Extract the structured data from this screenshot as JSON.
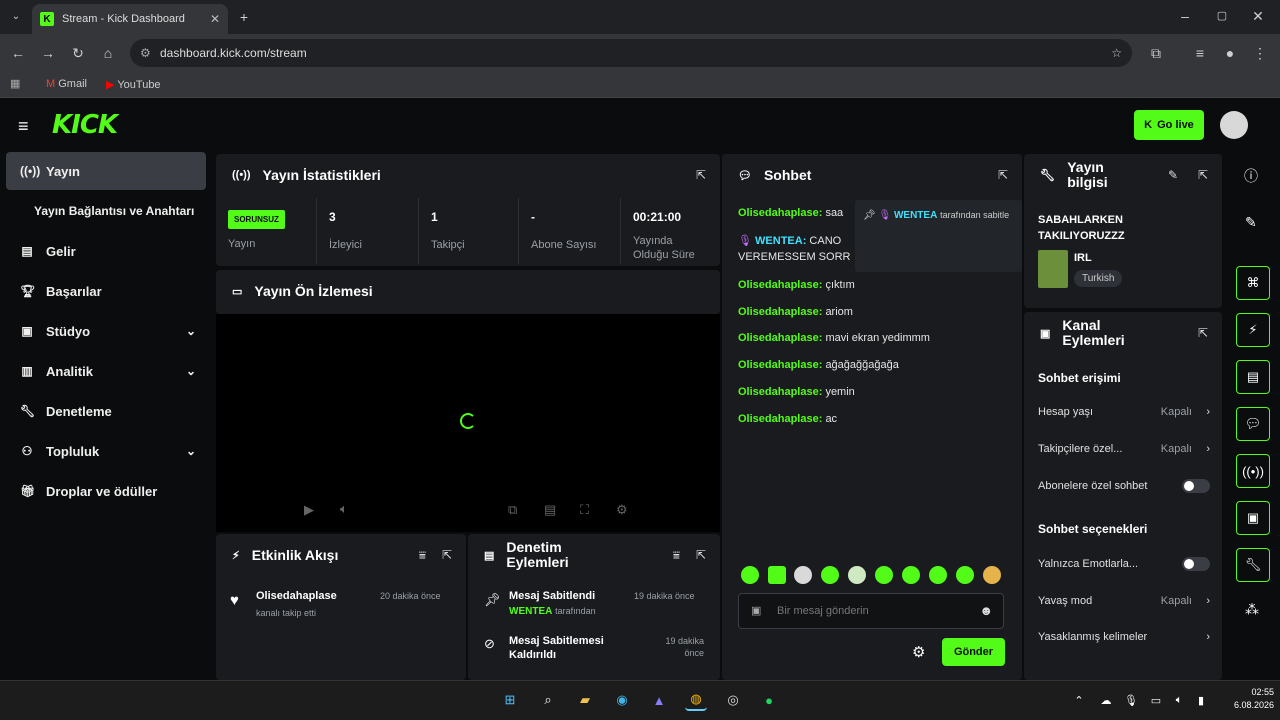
{
  "browser": {
    "tab_title": "Stream - Kick Dashboard",
    "url": "dashboard.kick.com/stream",
    "bookmarks": [
      "Gmail",
      "YouTube"
    ]
  },
  "header": {
    "logo": "KICK",
    "go_live": "Go live"
  },
  "sidebar": {
    "items": [
      {
        "label": "Yayın",
        "icon": "broadcast-icon"
      },
      {
        "label": "Yayın Bağlantısı ve Anahtarı",
        "icon": ""
      },
      {
        "label": "Gelir",
        "icon": "revenue-icon"
      },
      {
        "label": "Başarılar",
        "icon": "trophy-icon"
      },
      {
        "label": "Stüdyo",
        "icon": "studio-icon"
      },
      {
        "label": "Analitik",
        "icon": "analytics-icon"
      },
      {
        "label": "Denetleme",
        "icon": "wrench-icon"
      },
      {
        "label": "Topluluk",
        "icon": "community-icon"
      },
      {
        "label": "Droplar ve ödüller",
        "icon": "gift-icon"
      }
    ]
  },
  "stats": {
    "title": "Yayın İstatistikleri",
    "status_badge": "SORUNSUZ",
    "status_label": "Yayın",
    "viewers": {
      "value": "3",
      "label": "İzleyici"
    },
    "followers": {
      "value": "1",
      "label": "Takipçi"
    },
    "subs": {
      "value": "-",
      "label": "Abone Sayısı"
    },
    "uptime": {
      "value": "00:21:00",
      "label": "Yayında Olduğu Süre"
    }
  },
  "preview": {
    "title": "Yayın Ön İzlemesi"
  },
  "activity": {
    "title": "Etkinlik Akışı",
    "items": [
      {
        "user": "Olisedahaplase",
        "text": "kanalı takip etti",
        "time": "20 dakika önce"
      }
    ]
  },
  "moderation": {
    "title": "Denetim Eylemleri",
    "items": [
      {
        "title": "Mesaj Sabitlendi",
        "user": "WENTEA",
        "suffix": "tarafından",
        "time": "19 dakika önce"
      },
      {
        "title": "Mesaj Sabitlemesi Kaldırıldı",
        "time": "19 dakika önce"
      }
    ]
  },
  "chat": {
    "title": "Sohbet",
    "pinned": {
      "user": "WENTEA",
      "text": "tarafından sabitle"
    },
    "messages": [
      {
        "user": "Olisedahaplase:",
        "text": "saa"
      },
      {
        "user": "WENTEA:",
        "text": "CANO"
      },
      {
        "user": "",
        "text": "VEREMESSEM SORR"
      },
      {
        "user": "Olisedahaplase:",
        "text": "çıktım"
      },
      {
        "user": "Olisedahaplase:",
        "text": "ariom"
      },
      {
        "user": "Olisedahaplase:",
        "text": "mavi ekran yedimmm"
      },
      {
        "user": "Olisedahaplase:",
        "text": "ağağağğağağa"
      },
      {
        "user": "Olisedahaplase:",
        "text": "yemin"
      },
      {
        "user": "Olisedahaplase:",
        "text": "ac"
      }
    ],
    "input_placeholder": "Bir mesaj gönderin",
    "send": "Gönder"
  },
  "stream_info": {
    "title": "Yayın bilgisi",
    "stream_title": "SABAHLARKEN TAKILIYORUZZZ",
    "category": "IRL",
    "language": "Turkish"
  },
  "channel_actions": {
    "title": "Kanal Eylemleri",
    "chat_access_heading": "Sohbet erişimi",
    "account_age": {
      "label": "Hesap yaşı",
      "value": "Kapalı"
    },
    "followers_only": {
      "label": "Takipçilere özel...",
      "value": "Kapalı"
    },
    "subs_only": {
      "label": "Abonelere özel sohbet"
    },
    "chat_options_heading": "Sohbet seçenekleri",
    "emotes_only": {
      "label": "Yalnızca Emotlarla..."
    },
    "slow_mode": {
      "label": "Yavaş mod",
      "value": "Kapalı"
    },
    "banned_words": {
      "label": "Yasaklanmış kelimeler"
    }
  },
  "taskbar": {
    "time": "02:55",
    "date": "6.08.2026"
  },
  "colors": {
    "accent": "#53fc18",
    "panel": "#191b1f",
    "bg": "#0b0c0d"
  }
}
